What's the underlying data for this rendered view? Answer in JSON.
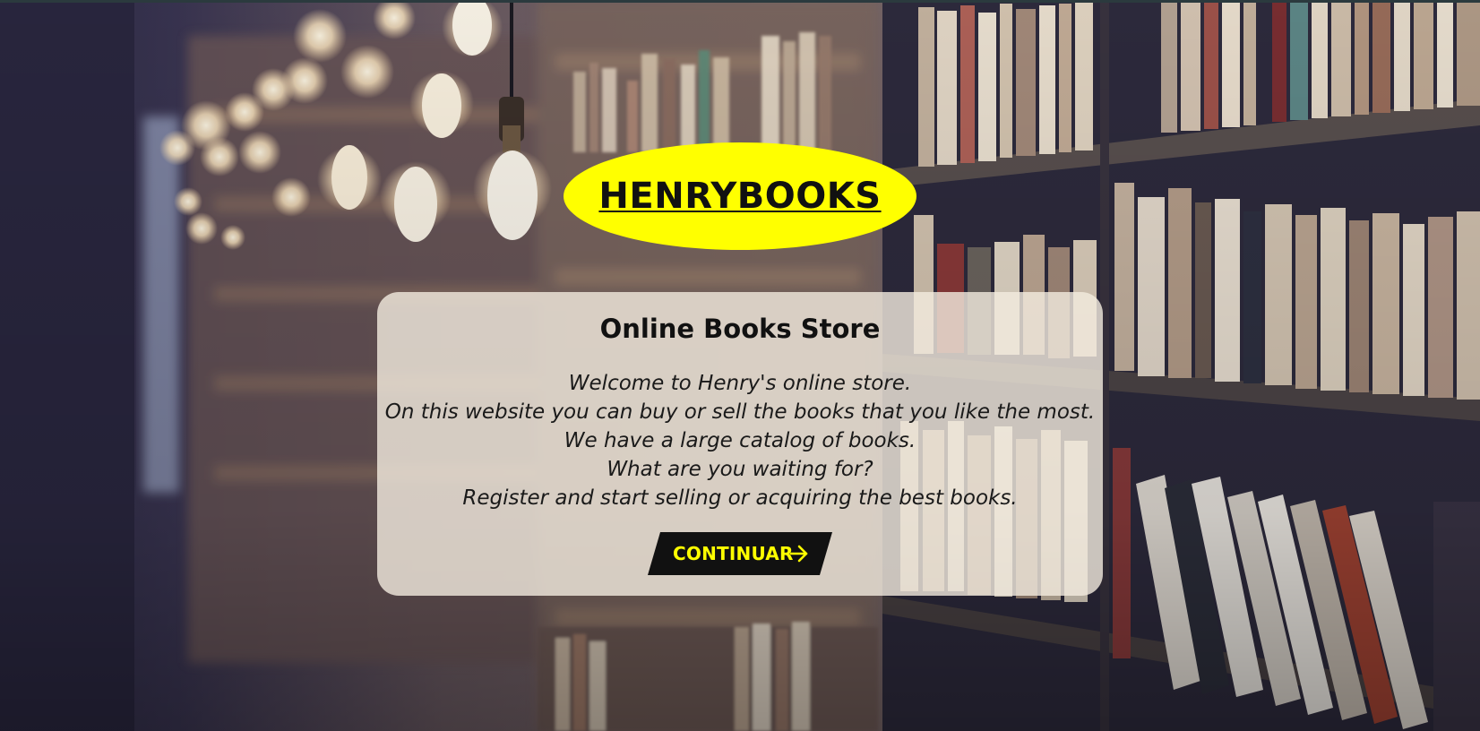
{
  "brand": {
    "name": "HENRYBOOKS",
    "color": "#ffff00"
  },
  "card": {
    "title": "Online Books Store",
    "lines": [
      "Welcome to Henry's online store.",
      "On this website you can buy or sell the books that you like the most.",
      "We have a large catalog of books.",
      "What are you waiting for?",
      "Register and start selling or acquiring the best books."
    ]
  },
  "cta": {
    "label": "CONTINUAR",
    "icon": "arrow-right-icon",
    "text_color": "#ffff00",
    "bg_color": "#111111"
  },
  "background": {
    "icon": "library-bookshelves-photo"
  }
}
